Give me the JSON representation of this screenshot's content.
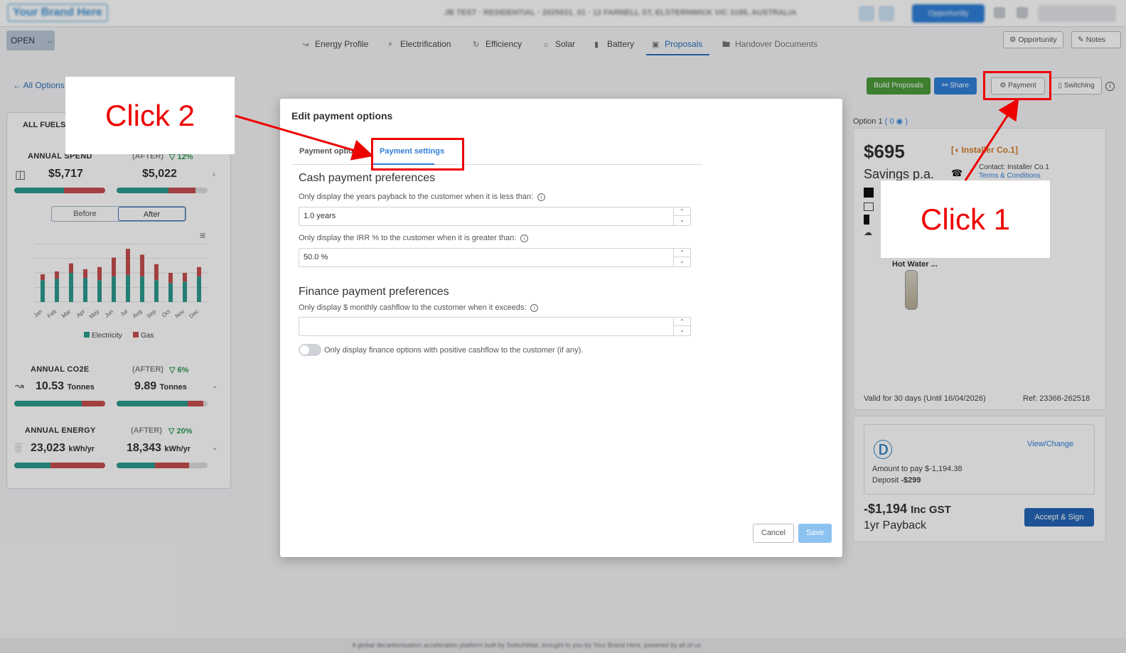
{
  "app": {
    "brand": "Your Brand Here",
    "breadcrumb": "JB TEST · RESIDENTIAL · 2025031_01 · 12 FARNELL ST, ELSTERNWICK VIC 3185, AUSTRALIA",
    "opportunity_top": "Opportunity"
  },
  "toolbar": {
    "open_label": "OPEN",
    "tabs": [
      {
        "label": "Energy Profile",
        "icon": "chart-line-icon"
      },
      {
        "label": "Electrification",
        "icon": "lightning-icon"
      },
      {
        "label": "Efficiency",
        "icon": "refresh-icon"
      },
      {
        "label": "Solar",
        "icon": "sun-icon"
      },
      {
        "label": "Battery",
        "icon": "battery-icon"
      },
      {
        "label": "Proposals",
        "icon": "proposal-icon"
      },
      {
        "label": "Handover Documents",
        "icon": "folder-icon"
      }
    ],
    "opportunity_btn": "Opportunity",
    "notes_btn": "Notes"
  },
  "page": {
    "all_options": "All Options",
    "build_proposals": "Build Proposals",
    "share": "Share",
    "payment": "Payment",
    "switching": "Switching"
  },
  "left": {
    "tab": "ALL FUELS",
    "spend_label": "ANNUAL SPEND",
    "after_label": "(AFTER)",
    "spend_pct": "▽ 12%",
    "spend_before": "$5,717",
    "spend_after": "$5,022",
    "seg_before": "Before",
    "seg_after": "After",
    "legend_electricity": "Electricity",
    "legend_gas": "Gas",
    "months": [
      "Jan",
      "Feb",
      "Mar",
      "Apr",
      "May",
      "Jun",
      "Jul",
      "Aug",
      "Sep",
      "Oct",
      "Nov",
      "Dec"
    ],
    "co2_label": "ANNUAL CO2E",
    "co2_pct": "▽ 6%",
    "co2_before": "10.53",
    "co2_after": "9.89",
    "co2_unit": "Tonnes",
    "energy_label": "ANNUAL ENERGY",
    "energy_pct": "▽ 20%",
    "energy_before": "23,023",
    "energy_after": "18,343",
    "energy_unit": "kWh/yr"
  },
  "chart_data": {
    "type": "bar",
    "categories": [
      "Jan",
      "Feb",
      "Mar",
      "Apr",
      "May",
      "Jun",
      "Jul",
      "Aug",
      "Sep",
      "Oct",
      "Nov",
      "Dec"
    ],
    "series": [
      {
        "name": "Electricity",
        "values": [
          30,
          32,
          40,
          33,
          30,
          35,
          37,
          35,
          30,
          26,
          28,
          35
        ]
      },
      {
        "name": "Gas",
        "values": [
          8,
          10,
          13,
          12,
          18,
          26,
          36,
          30,
          22,
          14,
          12,
          13
        ]
      }
    ],
    "colors": {
      "Electricity": "#2b9a8e",
      "Gas": "#c64f4f"
    },
    "legend": "bottom"
  },
  "right": {
    "option_label": "Option 1",
    "option_count": "( 0",
    "price": "$695",
    "savings": "Savings p.a.",
    "installer": "Installer Co.1",
    "contact": "Contact: Installer Co.1",
    "terms": "Terms & Conditions",
    "hot_water": "Hot Water ...",
    "valid": "Valid for 30 days (Until 16/04/2026)",
    "ref": "Ref: 23366-262518",
    "view_change": "View/Change",
    "amount_to_pay": "Amount to pay $-1,194.38",
    "deposit_label": "Deposit",
    "deposit_value": "-$299",
    "total": "-$1,194",
    "total_suffix": "Inc GST",
    "payback": "1yr Payback",
    "accept": "Accept & Sign"
  },
  "modal": {
    "title": "Edit payment options",
    "tab_options": "Payment options",
    "tab_settings": "Payment settings",
    "cash_heading": "Cash payment preferences",
    "payback_label": "Only display the years payback to the customer when it is less than:",
    "payback_value": "1.0 years",
    "irr_label": "Only display the IRR % to the customer when it is greater than:",
    "irr_value": "50.0 %",
    "finance_heading": "Finance payment preferences",
    "cashflow_label": "Only display $ monthly cashflow to the customer when it exceeds:",
    "cashflow_value": "",
    "toggle_label": "Only display finance options with positive cashflow to the customer (if any).",
    "cancel": "Cancel",
    "save": "Save"
  },
  "annotations": {
    "click1": "Click 1",
    "click2": "Click 2",
    "color": "#ee0000"
  },
  "footer": "A global decarbonisation acceleration platform built by SwitchWatt, brought to you by Your Brand Here, powered by all of us"
}
